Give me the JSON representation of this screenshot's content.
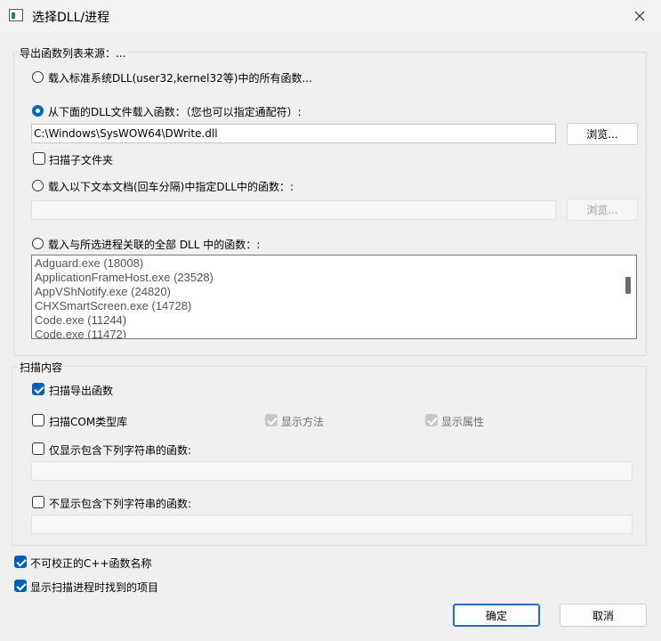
{
  "window": {
    "title": "选择DLL/进程"
  },
  "export_group": {
    "title": "导出函数列表来源：...",
    "opt_system": "载入标准系统DLL(user32,kernel32等)中的所有函数...",
    "opt_file": "从下面的DLL文件载入函数：（您也可以指定通配符）:",
    "file_path": "C:\\Windows\\SysWOW64\\DWrite.dll",
    "browse1": "浏览...",
    "scan_subfolders": "扫描子文件夹",
    "opt_textfile": "载入以下文本文档(回车分隔)中指定DLL中的函数：:",
    "browse2": "浏览...",
    "opt_process": "载入与所选进程关联的全部 DLL 中的函数：:",
    "processes": [
      "Adguard.exe  (18008)",
      "ApplicationFrameHost.exe  (23528)",
      "AppVShNotify.exe  (24820)",
      "CHXSmartScreen.exe  (14728)",
      "Code.exe  (11244)",
      "Code.exe  (11472)"
    ]
  },
  "scan_group": {
    "title": "扫描内容",
    "scan_exports": "扫描导出函数",
    "scan_com": "扫描COM类型库",
    "show_methods": "显示方法",
    "show_props": "显示属性",
    "only_containing": "仅显示包含下列字符串的函数:",
    "not_containing": "不显示包含下列字符串的函数:"
  },
  "options": {
    "cpp_names": "不可校正的C++函数名称",
    "show_found": "显示扫描进程时找到的项目"
  },
  "buttons": {
    "ok": "确定",
    "cancel": "取消"
  }
}
